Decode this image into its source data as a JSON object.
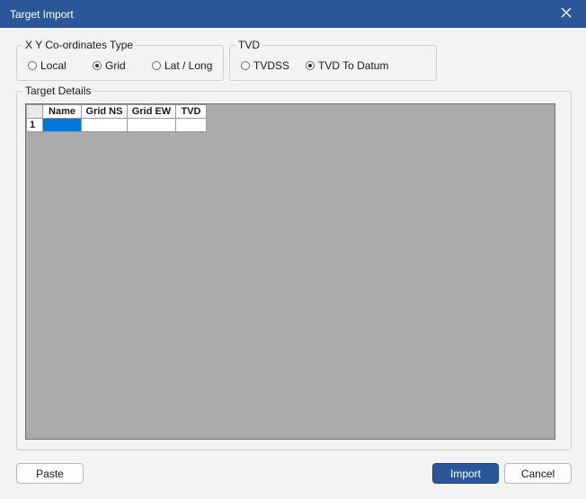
{
  "window": {
    "title": "Target Import"
  },
  "xy_group": {
    "legend": "X Y Co-ordinates Type",
    "options": [
      {
        "label": "Local",
        "selected": false
      },
      {
        "label": "Grid",
        "selected": true
      },
      {
        "label": "Lat / Long",
        "selected": false
      }
    ]
  },
  "tvd_group": {
    "legend": "TVD",
    "options": [
      {
        "label": "TVDSS",
        "selected": false
      },
      {
        "label": "TVD To Datum",
        "selected": true
      }
    ]
  },
  "details_group": {
    "legend": "Target Details",
    "table": {
      "columns": [
        "Name",
        "Grid NS",
        "Grid EW",
        "TVD"
      ],
      "rows": [
        {
          "row_label": "1",
          "cells": [
            "",
            "",
            "",
            ""
          ]
        }
      ]
    }
  },
  "buttons": {
    "paste": "Paste",
    "import": "Import",
    "cancel": "Cancel"
  },
  "colors": {
    "title_bar": "#2b579a",
    "primary_button": "#2b579a",
    "grid_background": "#ababab",
    "selected_cell": "#0078d7"
  },
  "icons": {
    "close": "close-icon"
  }
}
